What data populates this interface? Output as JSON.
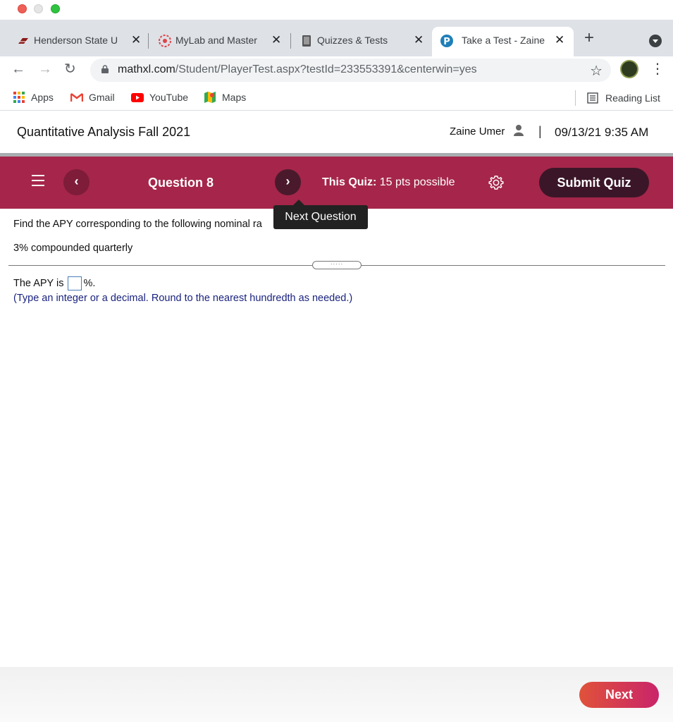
{
  "browser": {
    "tabs": [
      {
        "title": "Henderson State U",
        "active": false
      },
      {
        "title": "MyLab and Master",
        "active": false
      },
      {
        "title": "Quizzes & Tests",
        "active": false
      },
      {
        "title": "Take a Test - Zaine",
        "active": true
      }
    ],
    "new_tab": "+",
    "url_host": "mathxl.com",
    "url_path": "/Student/PlayerTest.aspx?testId=233553391&centerwin=yes",
    "bookmarks": [
      "Apps",
      "Gmail",
      "YouTube",
      "Maps"
    ],
    "reading_list": "Reading List"
  },
  "header": {
    "course": "Quantitative Analysis Fall 2021",
    "user": "Zaine Umer",
    "separator": "|",
    "datetime": "09/13/21 9:35 AM"
  },
  "quizbar": {
    "prev": "‹",
    "next": "›",
    "question": "Question 8",
    "quiz_label": "This Quiz:",
    "quiz_points": "15 pts possible",
    "submit": "Submit Quiz",
    "tooltip": "Next Question"
  },
  "question": {
    "prompt": "Find the APY corresponding to the following nominal ra",
    "given": "3% compounded quarterly",
    "answer_prefix": "The APY is",
    "answer_suffix": "%.",
    "hint": "(Type an integer or a decimal. Round to the nearest hundredth as needed.)",
    "handle": "·····"
  },
  "footer": {
    "next": "Next"
  },
  "colors": {
    "quizbar": "#a5264a",
    "submit": "#3b1628",
    "hint": "#1a237e"
  }
}
